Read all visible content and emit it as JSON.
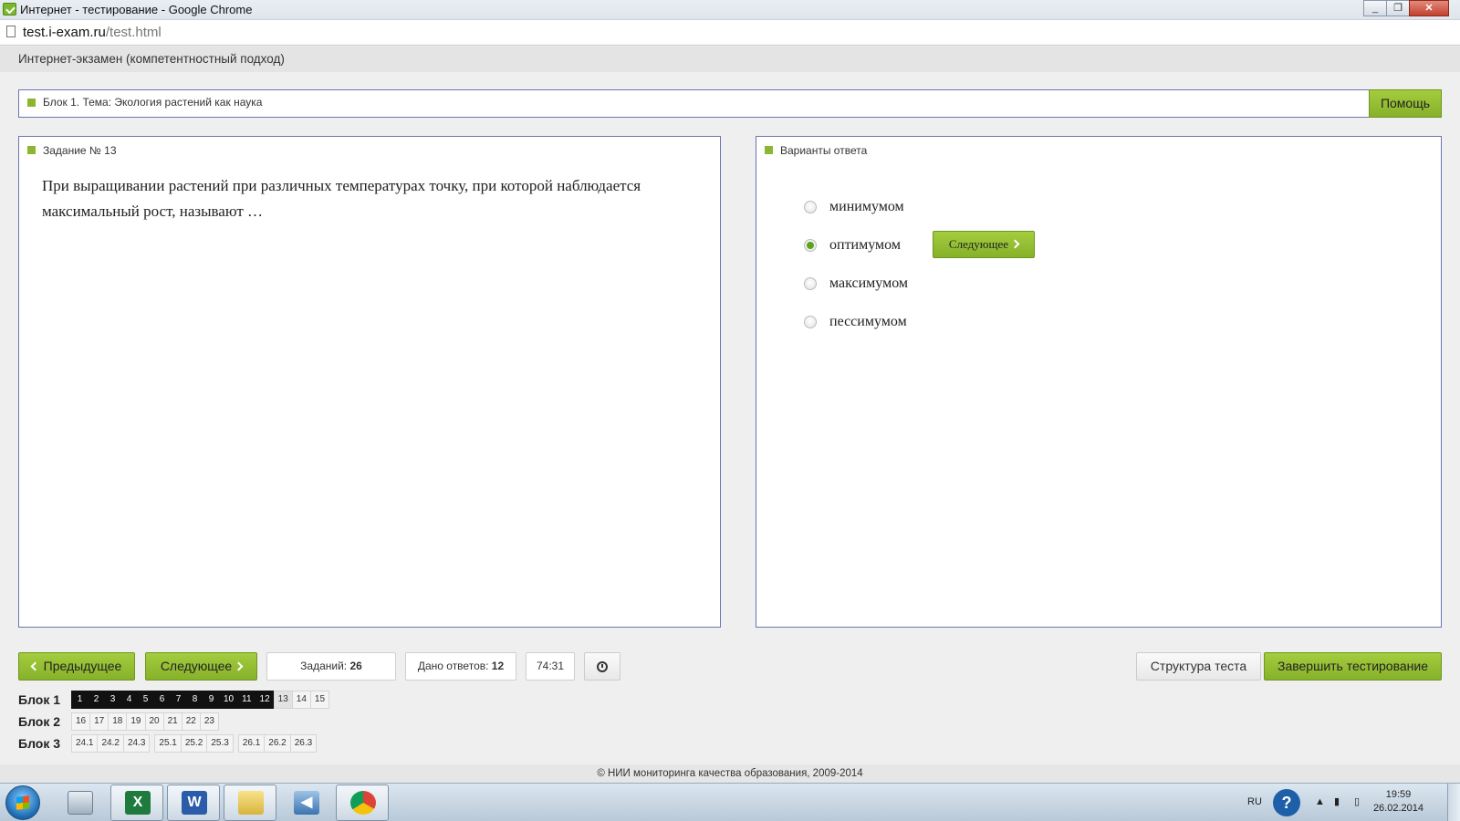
{
  "browser": {
    "window_title": "Интернет - тестирование - Google Chrome",
    "url_host": "test.i-exam.ru",
    "url_path": "/test.html",
    "controls": [
      "minimize",
      "maximize",
      "close"
    ]
  },
  "app": {
    "title": "Интернет-экзамен (компетентностный подход)",
    "block_label": "Блок 1. Тема: Экология растений как наука",
    "help_label": "Помощь"
  },
  "task": {
    "header": "Задание № 13",
    "question": "При выращивании растений при различных температурах точку, при которой наблюдается максимальный рост, называют …"
  },
  "answers": {
    "header": "Варианты ответа",
    "options": [
      {
        "label": "минимумом",
        "selected": false
      },
      {
        "label": "оптимумом",
        "selected": true
      },
      {
        "label": "максимумом",
        "selected": false
      },
      {
        "label": "пессимумом",
        "selected": false
      }
    ],
    "next_label": "Следующее"
  },
  "toolbar": {
    "prev_label": "Предыдущее",
    "next_label": "Следующее",
    "tasks_label": "Заданий:",
    "tasks_count": "26",
    "answered_label": "Дано ответов:",
    "answered_count": "12",
    "timer": "74:31",
    "structure_label": "Структура теста",
    "finish_label": "Завершить тестирование"
  },
  "navigation": {
    "blocks": [
      {
        "label": "Блок 1",
        "groups": [
          [
            "1",
            "2",
            "3",
            "4",
            "5",
            "6",
            "7",
            "8",
            "9",
            "10",
            "11",
            "12",
            "13",
            "14",
            "15"
          ]
        ],
        "answered_through": "12",
        "current": "13"
      },
      {
        "label": "Блок 2",
        "groups": [
          [
            "16",
            "17",
            "18",
            "19",
            "20",
            "21",
            "22",
            "23"
          ]
        ]
      },
      {
        "label": "Блок 3",
        "groups": [
          [
            "24.1",
            "24.2",
            "24.3"
          ],
          [
            "25.1",
            "25.2",
            "25.3"
          ],
          [
            "26.1",
            "26.2",
            "26.3"
          ]
        ]
      }
    ]
  },
  "footer": "© НИИ мониторинга качества образования, 2009-2014",
  "taskbar": {
    "apps": [
      "calculator-icon",
      "excel-icon",
      "word-icon",
      "explorer-icon",
      "media-icon",
      "chrome-icon"
    ],
    "lang": "RU",
    "time": "19:59",
    "date": "26.02.2014"
  }
}
